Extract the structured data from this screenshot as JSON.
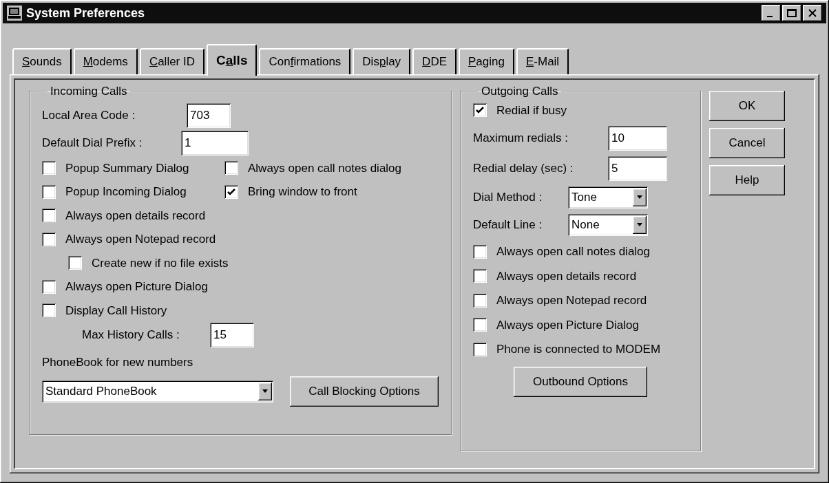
{
  "window": {
    "title": "System Preferences"
  },
  "tabs": [
    {
      "key": "S",
      "after": "ounds",
      "selected": false
    },
    {
      "key": "M",
      "after": "odems",
      "selected": false
    },
    {
      "key": "C",
      "after": "aller ID",
      "selected": false
    },
    {
      "before": "C",
      "key": "a",
      "after": "lls",
      "selected": true
    },
    {
      "before": "Con",
      "key": "f",
      "after": "irmations",
      "selected": false
    },
    {
      "before": "Dis",
      "key": "p",
      "after": "lay",
      "selected": false
    },
    {
      "key": "D",
      "after": "DE",
      "selected": false
    },
    {
      "key": "P",
      "after": "aging",
      "selected": false
    },
    {
      "key": "E",
      "after": "-Mail",
      "selected": false
    }
  ],
  "incoming": {
    "title": "Incoming Calls",
    "fields": [
      {
        "label": "Local Area Code :",
        "value": "703"
      },
      {
        "label": "Default Dial Prefix :",
        "value": "1"
      }
    ],
    "checkbox_grid": [
      [
        {
          "label": "Popup Summary Dialog",
          "checked": false
        },
        {
          "label": "Always open call notes dialog",
          "checked": false
        }
      ],
      [
        {
          "label": "Popup Incoming Dialog",
          "checked": false
        },
        {
          "label": "Bring window to front",
          "checked": true
        }
      ]
    ],
    "options": [
      {
        "kind": "checkbox",
        "label": "Always open details record",
        "checked": false
      },
      {
        "kind": "checkbox",
        "label": "Always open Notepad record",
        "checked": false,
        "children": [
          {
            "kind": "checkbox",
            "label": "Create new if no file exists",
            "checked": false
          }
        ]
      },
      {
        "kind": "checkbox",
        "label": "Always open Picture Dialog",
        "checked": false
      },
      {
        "kind": "checkbox",
        "label": "Display Call History",
        "checked": false,
        "children": [
          {
            "kind": "field",
            "label": "Max History Calls :",
            "value": "15"
          }
        ]
      }
    ],
    "phonebook": {
      "label": "PhoneBook for new numbers",
      "value": "Standard PhoneBook"
    },
    "button": "Call Blocking Options"
  },
  "outgoing": {
    "title": "Outgoing Calls",
    "redial": {
      "label": "Redial if busy",
      "checked": true
    },
    "fields": [
      {
        "kind": "text",
        "label": "Maximum redials :",
        "value": "10"
      },
      {
        "kind": "text",
        "label": "Redial delay (sec) :",
        "value": "5"
      },
      {
        "kind": "select",
        "label": "Dial Method :",
        "value": "Tone"
      },
      {
        "kind": "select",
        "label": "Default Line :",
        "value": "None"
      }
    ],
    "options": [
      {
        "label": "Always open call notes dialog",
        "checked": false
      },
      {
        "label": "Always open details record",
        "checked": false
      },
      {
        "label": "Always open Notepad record",
        "checked": false
      },
      {
        "label": "Always open Picture Dialog",
        "checked": false
      },
      {
        "label": "Phone is connected to MODEM",
        "checked": false
      }
    ],
    "button": "Outbound Options"
  },
  "buttons": [
    "OK",
    "Cancel",
    "Help"
  ]
}
